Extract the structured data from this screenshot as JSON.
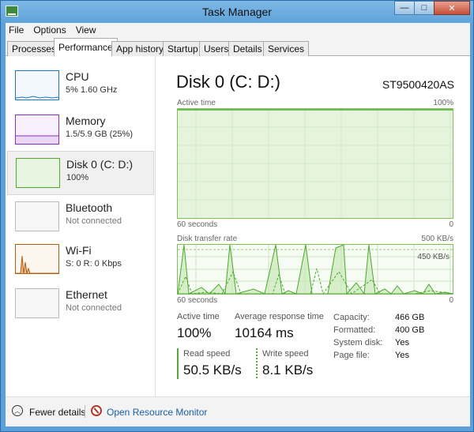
{
  "window": {
    "title": "Task Manager"
  },
  "window_buttons": {
    "minimize": "—",
    "maximize": "□",
    "close": "✕"
  },
  "menu": [
    "File",
    "Options",
    "View"
  ],
  "tabs": [
    {
      "label": "Processes",
      "active": false
    },
    {
      "label": "Performance",
      "active": true
    },
    {
      "label": "App history",
      "active": false
    },
    {
      "label": "Startup",
      "active": false
    },
    {
      "label": "Users",
      "active": false
    },
    {
      "label": "Details",
      "active": false
    },
    {
      "label": "Services",
      "active": false
    }
  ],
  "sidebar": {
    "items": [
      {
        "title": "CPU",
        "subtitle": "5%  1.60 GHz",
        "color": "#1779c4",
        "icon": "cpu-graph"
      },
      {
        "title": "Memory",
        "subtitle": "1.5/5.9 GB (25%)",
        "color": "#8a2ec4",
        "icon": "memory-graph"
      },
      {
        "title": "Disk 0 (C: D:)",
        "subtitle": "100%",
        "color": "#4da82e",
        "icon": "disk-graph"
      },
      {
        "title": "Bluetooth",
        "subtitle": "Not connected",
        "color": "#bbbbbb",
        "icon": "bluetooth-graph"
      },
      {
        "title": "Wi-Fi",
        "subtitle": "S: 0 R: 0 Kbps",
        "color": "#b25e10",
        "icon": "wifi-graph"
      },
      {
        "title": "Ethernet",
        "subtitle": "Not connected",
        "color": "#bbbbbb",
        "icon": "ethernet-graph"
      }
    ]
  },
  "main": {
    "title": "Disk 0 (C: D:)",
    "model": "ST9500420AS",
    "active_graph": {
      "label": "Active time",
      "max": "100%",
      "time_label": "60 seconds",
      "min": "0",
      "level": 1.0
    },
    "transfer_graph": {
      "label": "Disk transfer rate",
      "max": "500 KB/s",
      "scale_line": "450 KB/s",
      "time_label": "60 seconds",
      "min": "0"
    },
    "stats": {
      "active_time_label": "Active time",
      "active_time_value": "100%",
      "response_label": "Average response time",
      "response_value": "10164 ms",
      "read_label": "Read speed",
      "read_value": "50.5 KB/s",
      "write_label": "Write speed",
      "write_value": "8.1 KB/s"
    },
    "details": [
      {
        "key": "Capacity:",
        "value": "466 GB"
      },
      {
        "key": "Formatted:",
        "value": "400 GB"
      },
      {
        "key": "System disk:",
        "value": "Yes"
      },
      {
        "key": "Page file:",
        "value": "Yes"
      }
    ]
  },
  "footer": {
    "fewer_details": "Fewer details",
    "resource_monitor": "Open Resource Monitor"
  }
}
